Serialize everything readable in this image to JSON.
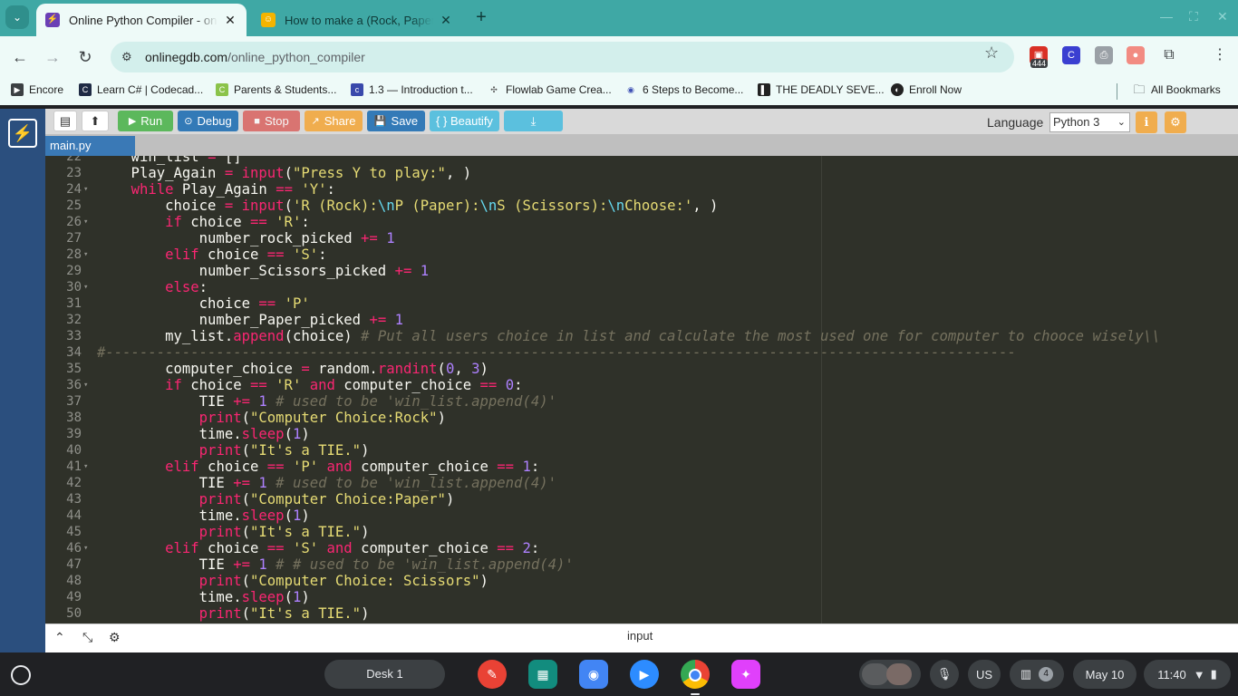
{
  "browser": {
    "tabs": [
      {
        "title": "Online Python Compiler - online editor",
        "active": true
      },
      {
        "title": "How to make a (Rock, Paper, Scissors)",
        "active": false
      }
    ],
    "url_host": "onlinegdb.com",
    "url_path": "/online_python_compiler",
    "extension_badge": "444",
    "bookmarks": [
      "Encore",
      "Learn C# | Codecad...",
      "Parents & Students...",
      "1.3 — Introduction t...",
      "Flowlab Game Crea...",
      "6 Steps to Become...",
      "THE DEADLY SEVE...",
      "Enroll Now"
    ],
    "all_bookmarks": "All Bookmarks"
  },
  "ide": {
    "buttons": {
      "run": "Run",
      "debug": "Debug",
      "stop": "Stop",
      "share": "Share",
      "save": "Save",
      "beautify": "{ } Beautify"
    },
    "language_label": "Language",
    "language_value": "Python 3",
    "file_tab": "main.py",
    "bottom_label": "input",
    "colors": {
      "run": "#5cb85c",
      "debug": "#337ab7",
      "stop": "#d9534f",
      "share": "#f0ad4e",
      "save": "#337ab7",
      "beautify": "#5bc0de",
      "download": "#5bc0de"
    }
  },
  "code": [
    {
      "n": "22",
      "fold": false,
      "text": "    win_list = []"
    },
    {
      "n": "23",
      "fold": false,
      "text": "    Play_Again = input(\"Press Y to play:\", )"
    },
    {
      "n": "24",
      "fold": true,
      "text": "    while Play_Again == 'Y':"
    },
    {
      "n": "25",
      "fold": false,
      "text": "        choice = input('R (Rock):\\nP (Paper):\\nS (Scissors):\\nChoose:', )"
    },
    {
      "n": "26",
      "fold": true,
      "text": "        if choice == 'R':"
    },
    {
      "n": "27",
      "fold": false,
      "text": "            number_rock_picked += 1"
    },
    {
      "n": "28",
      "fold": true,
      "text": "        elif choice == 'S':"
    },
    {
      "n": "29",
      "fold": false,
      "text": "            number_Scissors_picked += 1"
    },
    {
      "n": "30",
      "fold": true,
      "text": "        else:"
    },
    {
      "n": "31",
      "fold": false,
      "text": "            choice == 'P'"
    },
    {
      "n": "32",
      "fold": false,
      "text": "            number_Paper_picked += 1"
    },
    {
      "n": "33",
      "fold": false,
      "text": "        my_list.append(choice) # Put all users choice in list and calculate the most used one for computer to chooce wisely\\\\"
    },
    {
      "n": "34",
      "fold": false,
      "text": "#-----------------------------------------------------------------------------------------------------------"
    },
    {
      "n": "35",
      "fold": false,
      "text": "        computer_choice = random.randint(0, 3)"
    },
    {
      "n": "36",
      "fold": true,
      "text": "        if choice == 'R' and computer_choice == 0:"
    },
    {
      "n": "37",
      "fold": false,
      "text": "            TIE += 1 # used to be 'win_list.append(4)'"
    },
    {
      "n": "38",
      "fold": false,
      "text": "            print(\"Computer Choice:Rock\")"
    },
    {
      "n": "39",
      "fold": false,
      "text": "            time.sleep(1)"
    },
    {
      "n": "40",
      "fold": false,
      "text": "            print(\"It's a TIE.\")"
    },
    {
      "n": "41",
      "fold": true,
      "text": "        elif choice == 'P' and computer_choice == 1:"
    },
    {
      "n": "42",
      "fold": false,
      "text": "            TIE += 1 # used to be 'win_list.append(4)'"
    },
    {
      "n": "43",
      "fold": false,
      "text": "            print(\"Computer Choice:Paper\")"
    },
    {
      "n": "44",
      "fold": false,
      "text": "            time.sleep(1)"
    },
    {
      "n": "45",
      "fold": false,
      "text": "            print(\"It's a TIE.\")"
    },
    {
      "n": "46",
      "fold": true,
      "text": "        elif choice == 'S' and computer_choice == 2:"
    },
    {
      "n": "47",
      "fold": false,
      "text": "            TIE += 1 # # used to be 'win_list.append(4)'"
    },
    {
      "n": "48",
      "fold": false,
      "text": "            print(\"Computer Choice: Scissors\")"
    },
    {
      "n": "49",
      "fold": false,
      "text": "            time.sleep(1)"
    },
    {
      "n": "50",
      "fold": false,
      "text": "            print(\"It's a TIE.\")"
    }
  ],
  "shelf": {
    "desk": "Desk 1",
    "ime": "US",
    "notifications": "4",
    "date": "May 10",
    "time": "11:40"
  }
}
